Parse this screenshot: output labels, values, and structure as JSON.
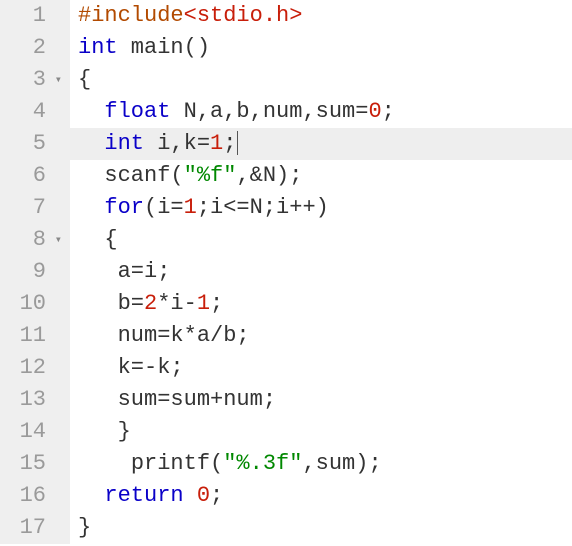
{
  "editor": {
    "language": "c",
    "highlighted_line": 5,
    "fold_markers": [
      3,
      8
    ],
    "line_numbers": [
      "1",
      "2",
      "3",
      "4",
      "5",
      "6",
      "7",
      "8",
      "9",
      "10",
      "11",
      "12",
      "13",
      "14",
      "15",
      "16",
      "17"
    ],
    "lines": {
      "l1": {
        "include_kw": "#include",
        "include_hdr": "<stdio.h>"
      },
      "l2": {
        "kw": "int",
        "rest": " main()"
      },
      "l3": {
        "text": "{"
      },
      "l4": {
        "kw": "float",
        "rest": " N,a,b,num,sum=",
        "num": "0",
        "tail": ";"
      },
      "l5": {
        "kw": "int",
        "rest": " i,k=",
        "num": "1",
        "tail": ";"
      },
      "l6": {
        "fn": "scanf",
        "open": "(",
        "str": "\"%f\"",
        "mid": ",&N)",
        "tail": ";"
      },
      "l7": {
        "kw": "for",
        "open": "(i=",
        "n1": "1",
        "mid1": ";i<=N;i++)",
        "tail": ""
      },
      "l8": {
        "text": "{"
      },
      "l9": {
        "text": " a=i;"
      },
      "l10": {
        "pre": " b=",
        "n1": "2",
        "mid": "*i-",
        "n2": "1",
        "tail": ";"
      },
      "l11": {
        "text": " num=k*a/b;"
      },
      "l12": {
        "text": " k=-k;"
      },
      "l13": {
        "text": " sum=sum+num;"
      },
      "l14": {
        "text": " }"
      },
      "l15": {
        "fn": "printf",
        "open": "(",
        "str": "\"%.3f\"",
        "mid": ",sum)",
        "tail": ";"
      },
      "l16": {
        "kw": "return",
        "sp": " ",
        "num": "0",
        "tail": ";"
      },
      "l17": {
        "text": "}"
      }
    }
  }
}
